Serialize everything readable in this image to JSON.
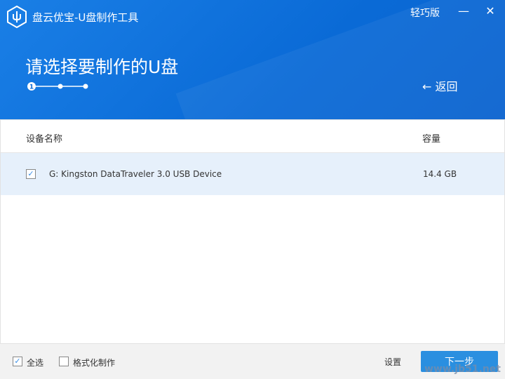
{
  "app": {
    "title": "盘云优宝-U盘制作工具",
    "lite_label": "轻巧版",
    "minimize": "—",
    "close": "✕"
  },
  "header": {
    "page_title": "请选择要制作的U盘",
    "step_current": "1",
    "back_label": "返回"
  },
  "table": {
    "columns": [
      "设备名称",
      "容量"
    ],
    "rows": [
      {
        "checked": true,
        "name": "G: Kingston DataTraveler 3.0 USB Device",
        "capacity": "14.4 GB"
      }
    ]
  },
  "footer": {
    "select_all": "全选",
    "format": "格式化制作",
    "settings": "设置",
    "next": "下一步"
  },
  "watermark": "www.jb51.net"
}
